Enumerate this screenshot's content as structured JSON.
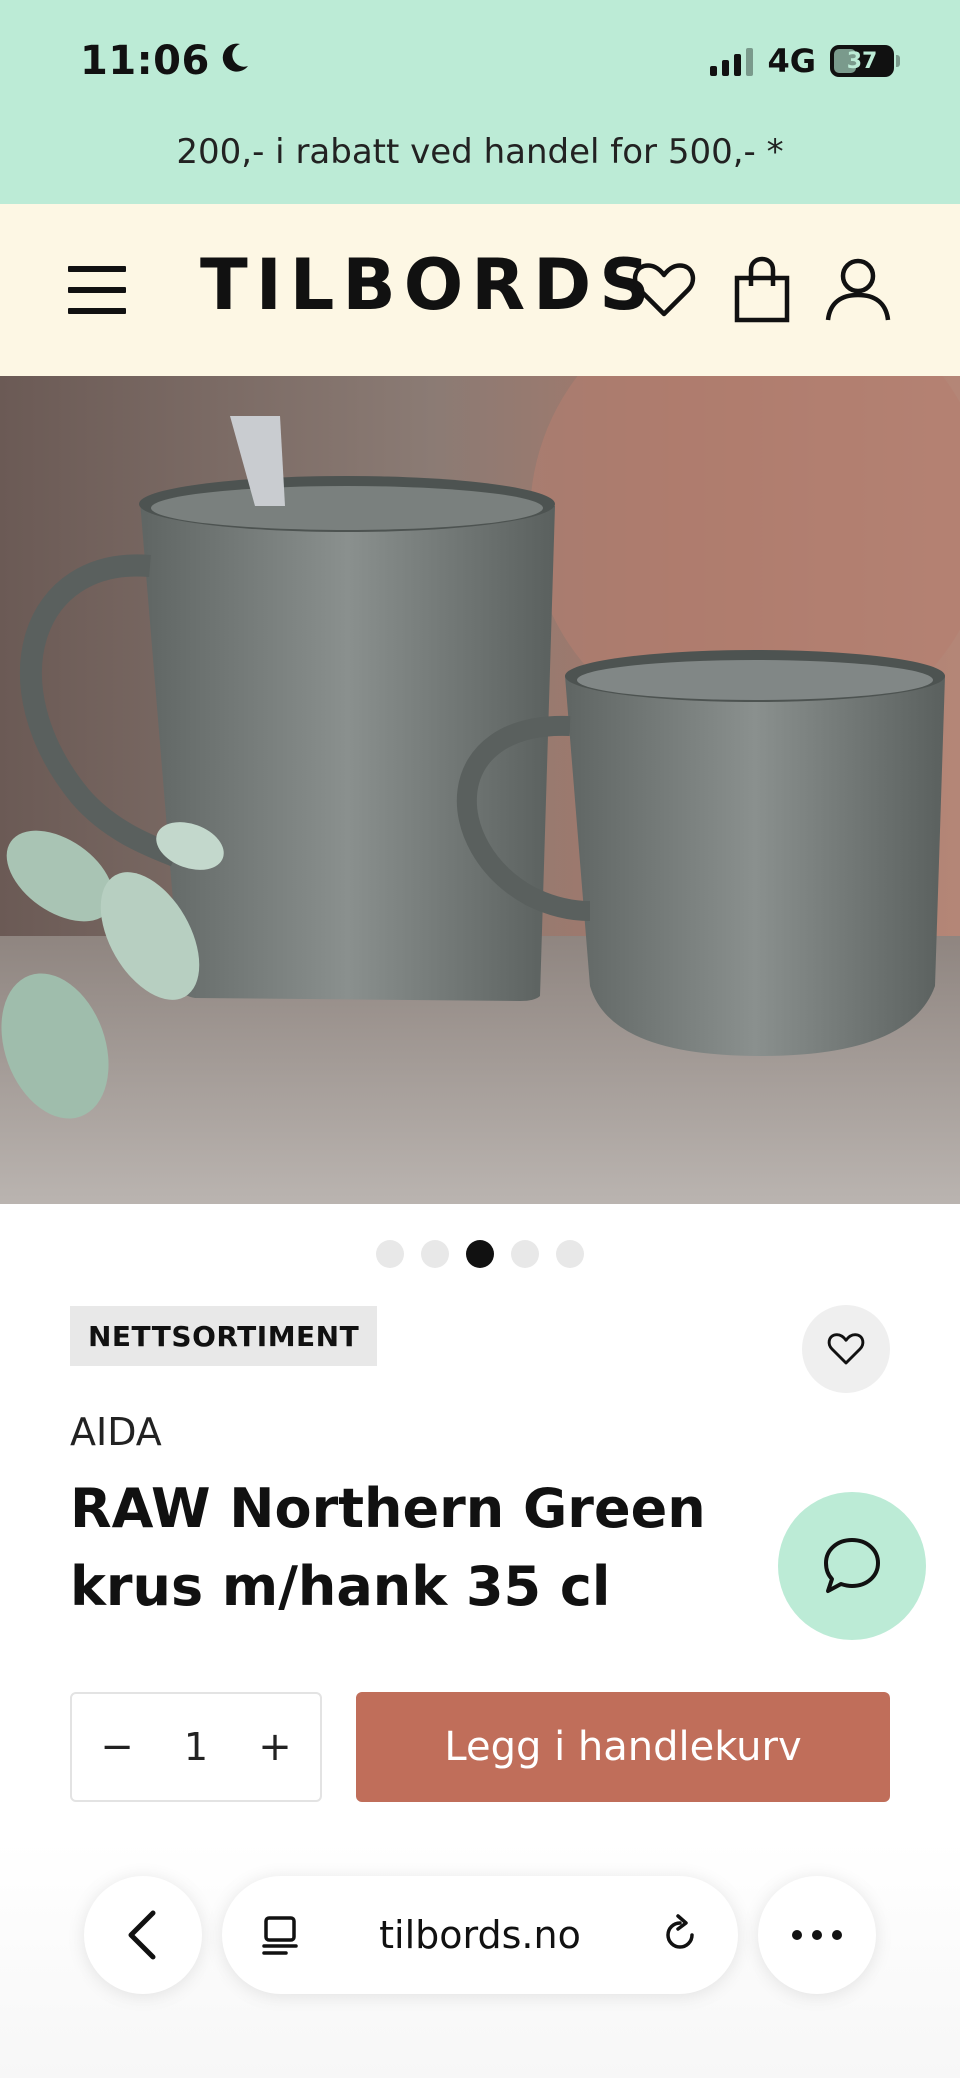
{
  "status_bar": {
    "time": "11:06",
    "network": "4G",
    "battery": "37",
    "moon_icon": "moon-icon",
    "signal_icon": "cellular-signal-icon"
  },
  "promo": {
    "text": "200,- i rabatt ved handel for 500,- *"
  },
  "header": {
    "logo": "TILBORDS",
    "icons": [
      "menu-icon",
      "heart-icon",
      "shopping-bag-icon",
      "user-icon"
    ]
  },
  "gallery": {
    "dots_count": 5,
    "active_index": 2
  },
  "product": {
    "badge": "NETTSORTIMENT",
    "brand": "AIDA",
    "title": "RAW Northern Green krus m/hank 35 cl",
    "quantity": "1",
    "minus": "−",
    "plus": "+",
    "add_to_cart": "Legg i handlekurv"
  },
  "browser": {
    "url": "tilbords.no"
  },
  "colors": {
    "promo_bg": "#bcebd6",
    "header_bg": "#fdf7e4",
    "add_button": "#c06e5a",
    "chat_button": "#bcebd6"
  }
}
